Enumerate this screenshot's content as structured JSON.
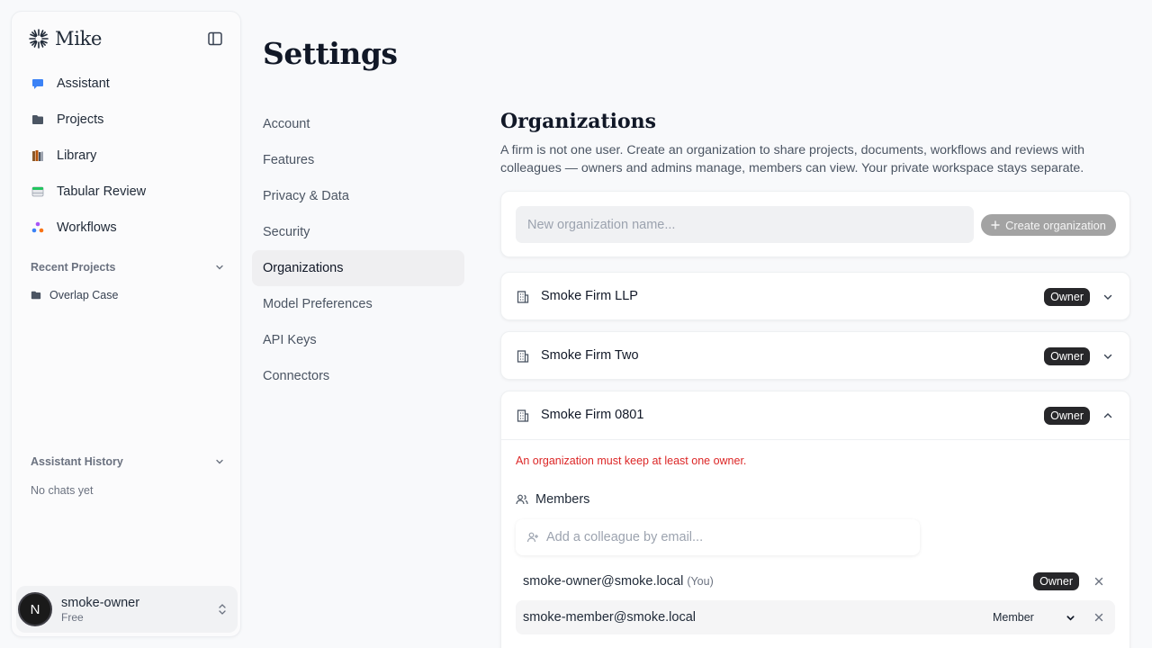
{
  "app": {
    "name": "Mike"
  },
  "sidebar": {
    "nav": [
      {
        "label": "Assistant",
        "icon": "chat-bubble-icon",
        "color": "#3b82f6"
      },
      {
        "label": "Projects",
        "icon": "folder-icon",
        "color": "#4b5563"
      },
      {
        "label": "Library",
        "icon": "books-icon",
        "color": "#8b5a2b"
      },
      {
        "label": "Tabular Review",
        "icon": "table-icon",
        "color": "#22c55e"
      },
      {
        "label": "Workflows",
        "icon": "workflow-icon",
        "color": "#a855f7"
      }
    ],
    "recent_projects": {
      "title": "Recent Projects",
      "items": [
        "Overlap Case"
      ]
    },
    "assistant_history": {
      "title": "Assistant History",
      "empty": "No chats yet"
    },
    "user": {
      "initial": "N",
      "name": "smoke-owner",
      "plan": "Free"
    }
  },
  "settings": {
    "title": "Settings",
    "nav": [
      "Account",
      "Features",
      "Privacy & Data",
      "Security",
      "Organizations",
      "Model Preferences",
      "API Keys",
      "Connectors"
    ],
    "active": "Organizations"
  },
  "organizations": {
    "heading": "Organizations",
    "description": "A firm is not one user. Create an organization to share projects, documents, workflows and reviews with colleagues — owners and admins manage, members can view. Your private workspace stays separate.",
    "create": {
      "placeholder": "New organization name...",
      "button": "Create organization"
    },
    "orgs": [
      {
        "name": "Smoke Firm LLP",
        "role": "Owner",
        "expanded": false
      },
      {
        "name": "Smoke Firm Two",
        "role": "Owner",
        "expanded": false
      },
      {
        "name": "Smoke Firm 0801",
        "role": "Owner",
        "expanded": true
      }
    ],
    "expanded": {
      "error": "An organization must keep at least one owner.",
      "members_title": "Members",
      "invite_placeholder": "Add a colleague by email...",
      "members": [
        {
          "email": "smoke-owner@smoke.local",
          "you": "(You)",
          "role": "Owner"
        },
        {
          "email": "smoke-member@smoke.local",
          "role": "Member"
        }
      ]
    }
  }
}
